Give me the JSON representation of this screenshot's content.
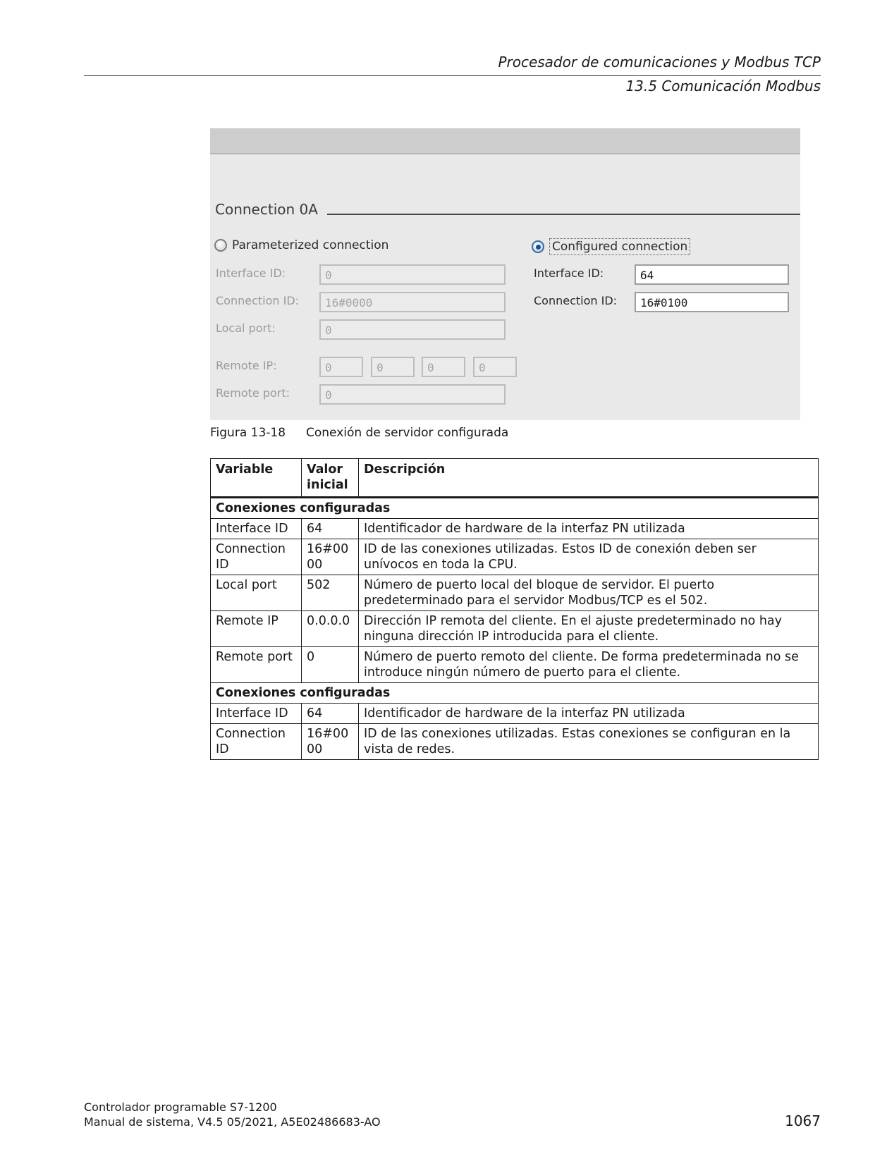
{
  "header": {
    "chapter": "Procesador de comunicaciones y Modbus TCP",
    "section": "13.5 Comunicación Modbus"
  },
  "figure": {
    "section_title": "Connection 0A",
    "parameterized": {
      "radio_label": "Parameterized connection",
      "interface_id_label": "Interface ID:",
      "interface_id_value": "0",
      "connection_id_label": "Connection ID:",
      "connection_id_value": "16#0000",
      "local_port_label": "Local port:",
      "local_port_value": "0",
      "remote_ip_label": "Remote IP:",
      "remote_ip_octets": [
        "0",
        "0",
        "0",
        "0"
      ],
      "remote_port_label": "Remote port:",
      "remote_port_value": "0"
    },
    "configured": {
      "radio_label": "Configured connection",
      "interface_id_label": "Interface ID:",
      "interface_id_value": "64",
      "connection_id_label": "Connection ID:",
      "connection_id_value": "16#0100"
    },
    "caption_number": "Figura 13-18",
    "caption_text": "Conexión de servidor configurada"
  },
  "table": {
    "headers": [
      "Variable",
      "Valor inicial",
      "Descripción"
    ],
    "group1": "Conexiones configuradas",
    "rows1": [
      [
        "Interface ID",
        "64",
        "Identificador de hardware de la interfaz PN utilizada"
      ],
      [
        "Connection ID",
        "16#0000",
        "ID de las conexiones utilizadas. Estos ID de conexión deben ser unívocos en toda la CPU."
      ],
      [
        "Local port",
        "502",
        "Número de puerto local del bloque de servidor. El puerto predeterminado para el servidor Modbus/TCP es el 502."
      ],
      [
        "Remote IP",
        "0.0.0.0",
        "Dirección IP remota del cliente. En el ajuste predeterminado no hay ninguna dirección IP introducida para el cliente."
      ],
      [
        "Remote port",
        "0",
        "Número de puerto remoto del cliente. De forma predeterminada no se introduce ningún número de puerto para el cliente."
      ]
    ],
    "group2": "Conexiones configuradas",
    "rows2": [
      [
        "Interface ID",
        "64",
        "Identificador de hardware de la interfaz PN utilizada"
      ],
      [
        "Connection ID",
        "16#0000",
        "ID de las conexiones utilizadas. Estas conexiones se configuran en la vista de redes."
      ]
    ]
  },
  "footer": {
    "line1": "Controlador programable S7-1200",
    "line2": "Manual de sistema, V4.5 05/2021, A5E02486683-AO",
    "page_number": "1067"
  }
}
